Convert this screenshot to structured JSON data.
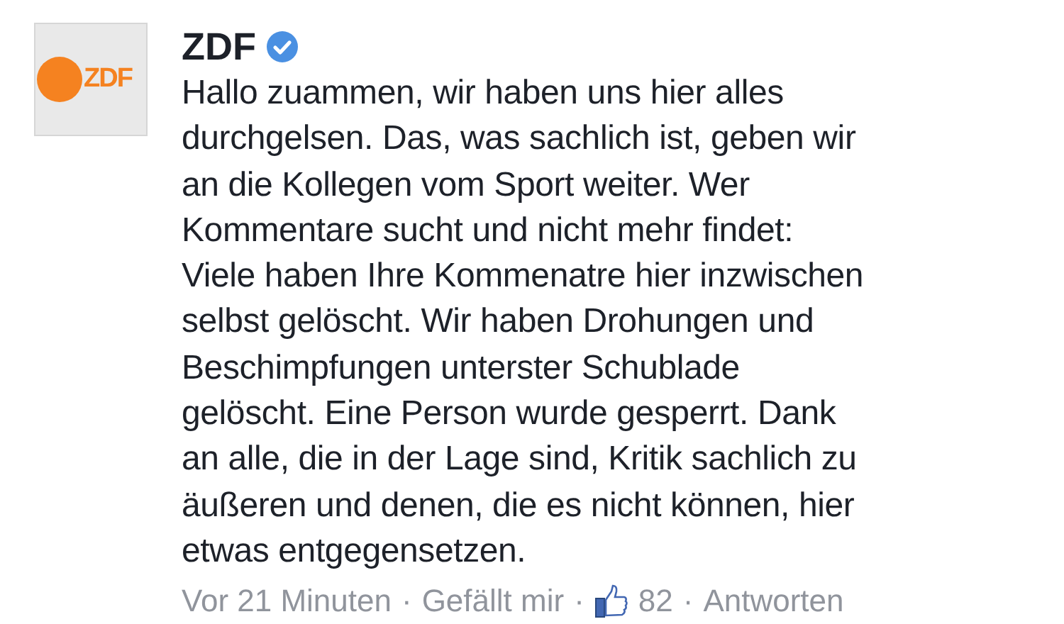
{
  "avatar": {
    "logo_text": "ZDF"
  },
  "comment": {
    "author": "ZDF",
    "verified": true,
    "text": "Hallo zuammen, wir haben uns hier alles\ndurchgelsen. Das, was sachlich ist, geben wir\nan die Kollegen vom Sport weiter. Wer\nKommentare sucht und nicht mehr findet:\nViele haben Ihre Kommenatre hier inzwischen\nselbst gelöscht. Wir haben Drohungen und\nBeschimpfungen unterster Schublade\ngelöscht. Eine Person wurde gesperrt. Dank\nan alle, die in der Lage sind, Kritik sachlich zu\näußeren und denen, die es nicht können, hier\netwas entgegensetzen."
  },
  "footer": {
    "time": "Vor 21 Minuten",
    "separator": "·",
    "like": "Gefällt mir",
    "like_count": "82",
    "reply": "Antworten"
  }
}
